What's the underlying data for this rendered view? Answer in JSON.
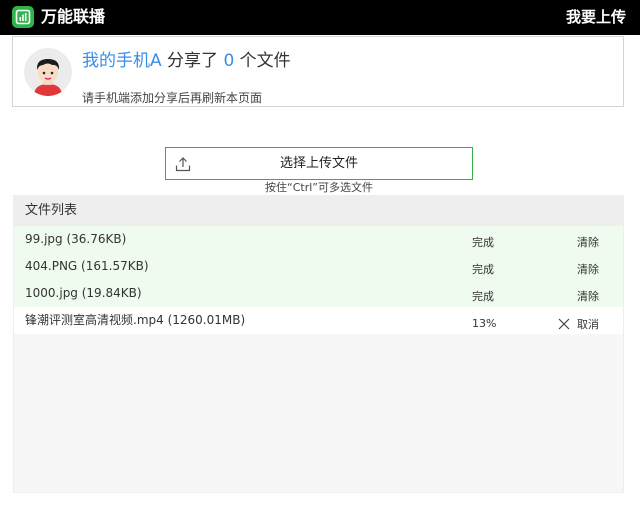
{
  "header": {
    "app_name": "万能联播",
    "upload_link": "我要上传"
  },
  "profile": {
    "device_name": "我的手机A",
    "share_text_1": " 分享了 ",
    "file_count": "0",
    "share_text_2": " 个文件",
    "hint": "请手机端添加分享后再刷新本页面"
  },
  "upload": {
    "button_label": "选择上传文件",
    "multi_select_hint": "按住“Ctrl”可多选文件"
  },
  "file_list": {
    "title": "文件列表",
    "rows": [
      {
        "name": "99.jpg (36.76KB)",
        "status": "完成",
        "action": "清除"
      },
      {
        "name": "404.PNG (161.57KB)",
        "status": "完成",
        "action": "清除"
      },
      {
        "name": "1000.jpg (19.84KB)",
        "status": "完成",
        "action": "清除"
      },
      {
        "name": "锋潮评测室高清视频.mp4 (1260.01MB)",
        "status": "13%",
        "action": "取消"
      }
    ]
  },
  "colors": {
    "brand_green": "#2fb34a",
    "accent_blue": "#3a8ee6",
    "done_row_bg": "#eefbee"
  },
  "icons": {
    "logo": "broadcast-logo-icon",
    "upload": "upload-icon",
    "cancel": "close-icon"
  }
}
